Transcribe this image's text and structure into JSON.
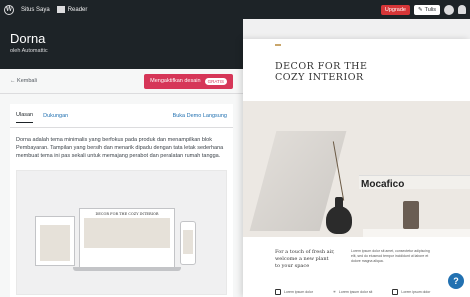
{
  "adminbar": {
    "site_name": "Situs Saya",
    "reader": "Reader",
    "upgrade": "Upgrade",
    "write": "Tulis"
  },
  "theme": {
    "name": "Dorna",
    "author": "oleh Automattic"
  },
  "actions": {
    "back": "← Kembali",
    "activate": "Mengaktifkan desain",
    "free_badge": "GRATIS"
  },
  "tabs": [
    {
      "label": "Ulasan",
      "active": true
    },
    {
      "label": "Dukungan",
      "active": false
    }
  ],
  "demo_link": "Buka Demo Langsung",
  "description": "Dorna adalah tema minimalis yang berfokus pada produk dan menampilkan blok Pembayaran. Tampilan yang bersih dan menarik dipadu dengan tata letak sederhana membuat tema ini pas sekali untuk memajang perabot dan peralatan rumah tangga.",
  "preview": {
    "hero_title": "DECOR FOR THE COZY INTERIOR",
    "device_title": "DECOR FOR THE COZY INTERIOR",
    "book_title": "Mocafico",
    "lead_text": "For a touch of fresh air, welcome a new plant to your space",
    "body_text": "Lorem ipsum dolor sit amet, consectetur adipiscing elit, sed do eiusmod tempor incididunt ut labore et dolore magna aliqua.",
    "features": [
      "Lorem ipsum dolor",
      "Lorem ipsum dolor sit",
      "Lorem ipsum dolor"
    ]
  },
  "help_label": "?",
  "colors": {
    "adminbar": "#1d2327",
    "activate": "#d63658",
    "link": "#2271b1"
  }
}
